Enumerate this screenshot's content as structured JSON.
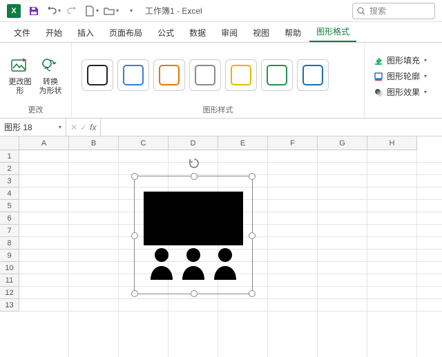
{
  "titlebar": {
    "title": "工作簿1 - Excel",
    "search_placeholder": "搜索"
  },
  "tabs": [
    "文件",
    "开始",
    "插入",
    "页面布局",
    "公式",
    "数据",
    "审阅",
    "视图",
    "帮助",
    "图形格式"
  ],
  "tabs_active_index": 9,
  "ribbon": {
    "change_group_label": "更改",
    "change_graphic_label": "更改图\n形",
    "convert_label": "转换\n为形状",
    "styles_group_label": "图形样式",
    "style_colors": [
      "#222",
      "#3a7bd5",
      "#e07a00",
      "#8a8a8a",
      "#e5b800",
      "#2e8b57",
      "#1c6ea4"
    ],
    "fill_label": "图形填充",
    "outline_label": "图形轮廓",
    "effect_label": "图形效果"
  },
  "namebox": {
    "value": "图形 18"
  },
  "grid": {
    "columns": [
      "A",
      "B",
      "C",
      "D",
      "E",
      "F",
      "G",
      "H"
    ],
    "rows": [
      1,
      2,
      3,
      4,
      5,
      6,
      7,
      8,
      9,
      10,
      11,
      12,
      13
    ]
  }
}
